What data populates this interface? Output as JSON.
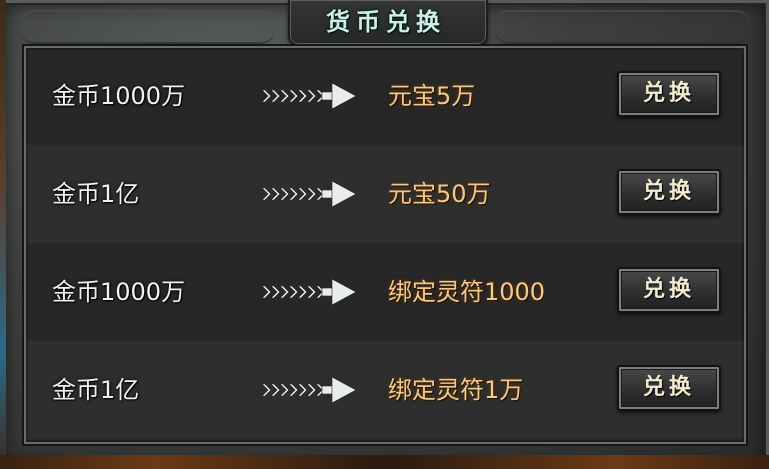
{
  "window": {
    "title": "货币兑换"
  },
  "exchanges": [
    {
      "cost": "金币1000万",
      "reward": "元宝5万",
      "button": "兑换"
    },
    {
      "cost": "金币1亿",
      "reward": "元宝50万",
      "button": "兑换"
    },
    {
      "cost": "金币1000万",
      "reward": "绑定灵符1000",
      "button": "兑换"
    },
    {
      "cost": "金币1亿",
      "reward": "绑定灵符1万",
      "button": "兑换"
    }
  ],
  "icons": {
    "arrow": "chevron-arrow-right-icon"
  },
  "colors": {
    "title": "#cfeee8",
    "cost_text": "#eef2f2",
    "reward_text": "#f2c98e",
    "button_text": "#f4ecd2"
  }
}
